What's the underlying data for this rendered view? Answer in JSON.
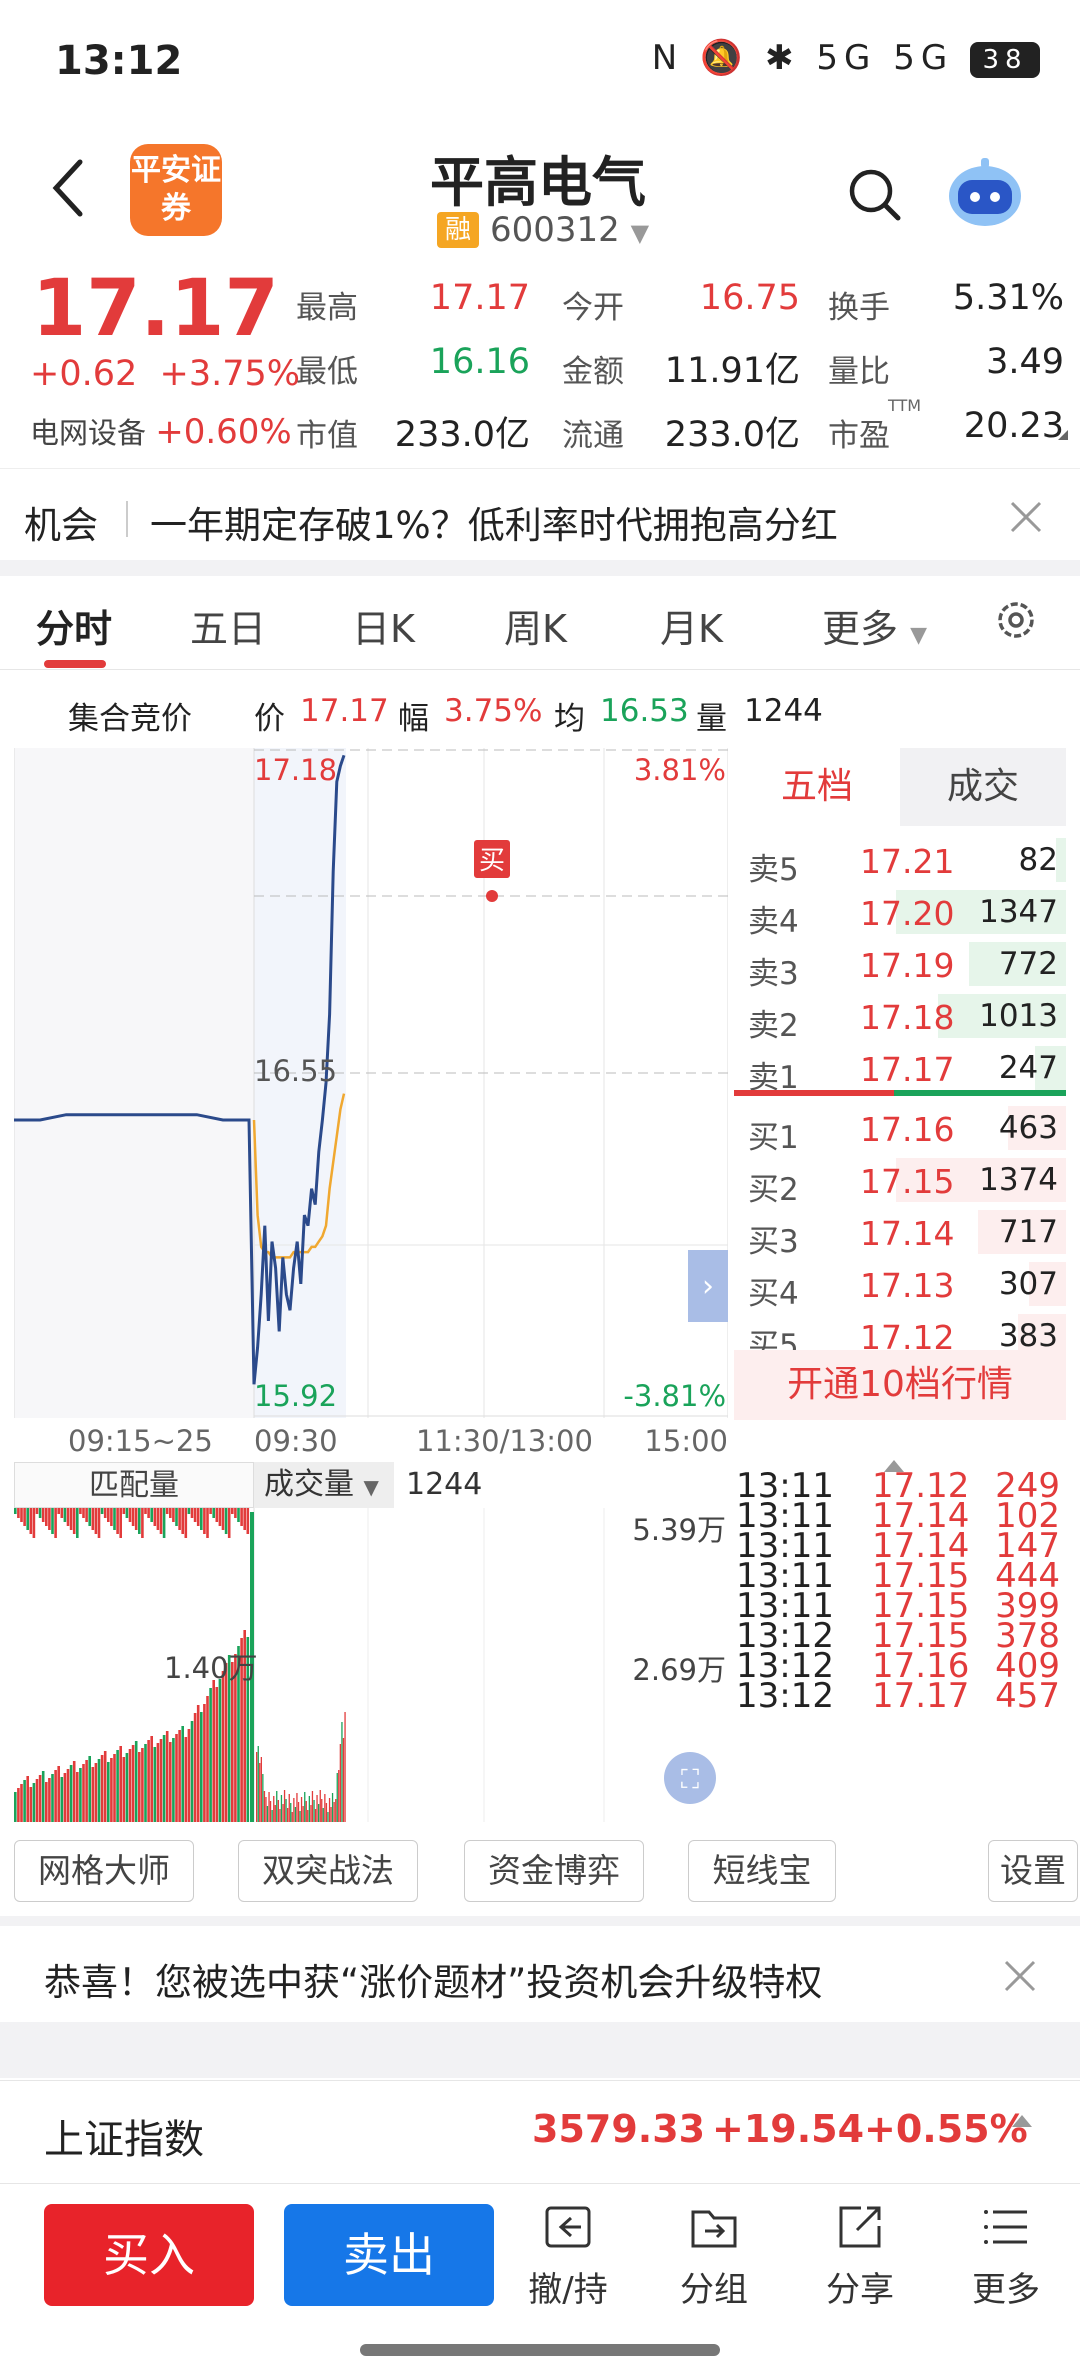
{
  "status_bar": {
    "time": "13:12",
    "icons": "N 🔕 ✱ 5G 5G",
    "battery": "38"
  },
  "header": {
    "logo_text": "平安证券",
    "stock_name": "平高电气",
    "badge": "融",
    "code": "600312"
  },
  "quote": {
    "price": "17.17",
    "change_abs": "+0.62",
    "change_pct": "+3.75%",
    "sector_name": "电网设备",
    "sector_change": "+0.60%",
    "stats": [
      {
        "label": "最高",
        "value": "17.17",
        "color": "#e23b3b"
      },
      {
        "label": "今开",
        "value": "16.75",
        "color": "#e23b3b"
      },
      {
        "label": "换手",
        "value": "5.31%",
        "color": "#222222"
      },
      {
        "label": "最低",
        "value": "16.16",
        "color": "#1aa35a"
      },
      {
        "label": "金额",
        "value": "11.91亿",
        "color": "#222222"
      },
      {
        "label": "量比",
        "value": "3.49",
        "color": "#222222"
      },
      {
        "label": "市值",
        "value": "233.0亿",
        "color": "#222222"
      },
      {
        "label": "流通",
        "value": "233.0亿",
        "color": "#222222"
      },
      {
        "label": "市盈",
        "value": "20.23",
        "color": "#222222",
        "sup": "TTM"
      }
    ]
  },
  "opportunity": {
    "tag": "机会",
    "text": "一年期定存破1%？低利率时代拥抱高分红"
  },
  "tabs": [
    "分时",
    "五日",
    "日K",
    "周K",
    "月K",
    "更多"
  ],
  "info_row": {
    "title": "集合竞价",
    "price_label": "价",
    "price": "17.17",
    "amp_label": "幅",
    "amp": "3.75%",
    "avg_label": "均",
    "avg": "16.53",
    "vol_label": "量",
    "vol": "1244"
  },
  "chart_data": {
    "type": "line",
    "y_top": "17.18",
    "y_mid": "16.55",
    "y_bottom": "15.92",
    "pct_top": "3.81%",
    "pct_bottom": "-3.81%",
    "buy_marker": "买",
    "ylim": [
      15.92,
      17.18
    ],
    "x_ticks": [
      "09:15~25",
      "09:30",
      "11:30/13:00",
      "15:00"
    ],
    "series": [
      {
        "color": "#2b4a8b",
        "values": [
          16.48,
          16.48,
          16.49,
          16.49,
          16.49,
          16.49,
          16.49,
          16.49,
          16.48,
          16.48,
          15.98,
          16.05,
          16.15,
          16.28,
          16.1,
          16.25,
          16.2,
          16.08,
          16.22,
          16.15,
          16.12,
          16.2,
          16.25,
          16.17,
          16.3,
          16.28,
          16.35,
          16.32,
          16.42,
          16.48,
          16.55,
          16.68,
          16.95,
          17.12,
          17.15,
          17.17
        ]
      },
      {
        "color": "#f0a830",
        "values": [
          16.48,
          16.48,
          16.48,
          16.48,
          16.48,
          16.48,
          16.48,
          16.48,
          16.48,
          16.48,
          16.48,
          16.3,
          16.24,
          16.23,
          16.23,
          16.22,
          16.22,
          16.22,
          16.22,
          16.22,
          16.22,
          16.23,
          16.23,
          16.23,
          16.23,
          16.23,
          16.24,
          16.24,
          16.25,
          16.26,
          16.28,
          16.35,
          16.4,
          16.45,
          16.5,
          16.53
        ]
      }
    ]
  },
  "order_book": {
    "tab_active": "五档",
    "tab_other": "成交",
    "asks": [
      {
        "label": "卖5",
        "price": "17.21",
        "vol": "82",
        "ratio": 0.06
      },
      {
        "label": "卖4",
        "price": "17.20",
        "vol": "1347",
        "ratio": 1.0
      },
      {
        "label": "卖3",
        "price": "17.19",
        "vol": "772",
        "ratio": 0.57
      },
      {
        "label": "卖2",
        "price": "17.18",
        "vol": "1013",
        "ratio": 0.75
      },
      {
        "label": "卖1",
        "price": "17.17",
        "vol": "247",
        "ratio": 0.18
      }
    ],
    "bids": [
      {
        "label": "买1",
        "price": "17.16",
        "vol": "463",
        "ratio": 0.34
      },
      {
        "label": "买2",
        "price": "17.15",
        "vol": "1374",
        "ratio": 1.0
      },
      {
        "label": "买3",
        "price": "17.14",
        "vol": "717",
        "ratio": 0.52
      },
      {
        "label": "买4",
        "price": "17.13",
        "vol": "307",
        "ratio": 0.22
      },
      {
        "label": "买5",
        "price": "17.12",
        "vol": "383",
        "ratio": 0.28
      }
    ],
    "upgrade": "开通10档行情"
  },
  "volume": {
    "left_label": "匹配量",
    "select_label": "成交量",
    "value": "1244",
    "top": "5.39万",
    "mid": "2.69万",
    "left_mark": "1.40万"
  },
  "trades": [
    {
      "time": "13:11",
      "price": "17.12",
      "vol": "249"
    },
    {
      "time": "13:11",
      "price": "17.14",
      "vol": "102"
    },
    {
      "time": "13:11",
      "price": "17.14",
      "vol": "147"
    },
    {
      "time": "13:11",
      "price": "17.15",
      "vol": "444"
    },
    {
      "time": "13:11",
      "price": "17.15",
      "vol": "399"
    },
    {
      "time": "13:12",
      "price": "17.15",
      "vol": "378"
    },
    {
      "time": "13:12",
      "price": "17.16",
      "vol": "409"
    },
    {
      "time": "13:12",
      "price": "17.17",
      "vol": "457"
    }
  ],
  "tools": [
    "网格大师",
    "双突战法",
    "资金博弈",
    "短线宝",
    "设置"
  ],
  "promo": "恭喜！您被选中获“涨价题材”投资机会升级特权",
  "index": {
    "name": "上证指数",
    "value": "3579.33",
    "change": "+19.54",
    "pct": "+0.55%"
  },
  "bottom": {
    "buy": "买入",
    "sell": "卖出",
    "items": [
      "撤/持",
      "分组",
      "分享",
      "更多"
    ]
  },
  "colors": {
    "up": "#e23b3b",
    "down": "#1aa35a",
    "line": "#2b4a8b",
    "avg": "#f0a830"
  }
}
